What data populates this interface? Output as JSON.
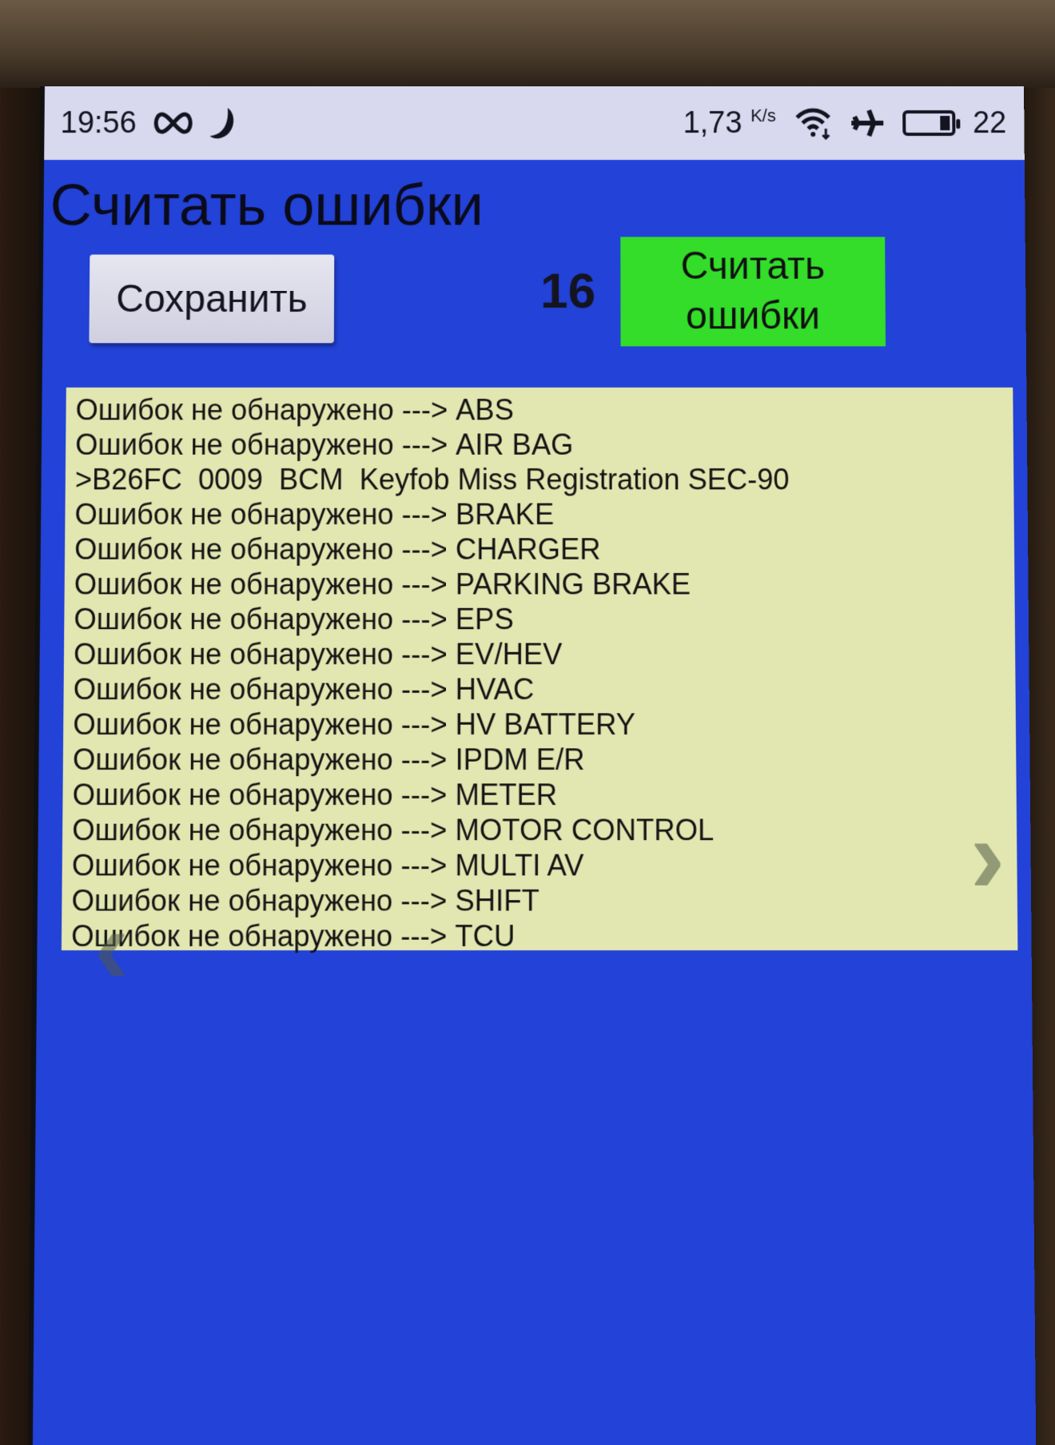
{
  "status_bar": {
    "time": "19:56",
    "icons_left": [
      "infinity-icon",
      "moon-icon"
    ],
    "net_speed_value": "1,73",
    "net_speed_unit": "K/s",
    "icons_right": [
      "wifi-icon",
      "airplane-icon",
      "battery-icon"
    ],
    "battery_level": "22",
    "battery_fraction": 0.22
  },
  "page": {
    "title": "Считать ошибки"
  },
  "toolbar": {
    "save_label": "Сохранить",
    "error_count": "16",
    "read_errors_label_line1": "Считать",
    "read_errors_label_line2": "ошибки"
  },
  "colors": {
    "background": "#2242d8",
    "results_panel": "#e2e6b0",
    "read_button": "#33dd2a",
    "save_button": "#d8d8e8"
  },
  "results": [
    "Ошибок не обнаружено ---> ABS",
    "Ошибок не обнаружено ---> AIR BAG",
    ">B26FC  0009  BCM  Keyfob Miss Registration SEC-90",
    "Ошибок не обнаружено ---> BRAKE",
    "Ошибок не обнаружено ---> CHARGER",
    "Ошибок не обнаружено ---> PARKING BRAKE",
    "Ошибок не обнаружено ---> EPS",
    "Ошибок не обнаружено ---> EV/HEV",
    "Ошибок не обнаружено ---> HVAC",
    "Ошибок не обнаружено ---> HV BATTERY",
    "Ошибок не обнаружено ---> IPDM E/R",
    "Ошибок не обнаружено ---> METER",
    "Ошибок не обнаружено ---> MOTOR CONTROL",
    "Ошибок не обнаружено ---> MULTI AV",
    "Ошибок не обнаружено ---> SHIFT",
    "Ошибок не обнаружено ---> TCU"
  ],
  "nav": {
    "prev_glyph": "‹",
    "next_glyph": "›"
  }
}
